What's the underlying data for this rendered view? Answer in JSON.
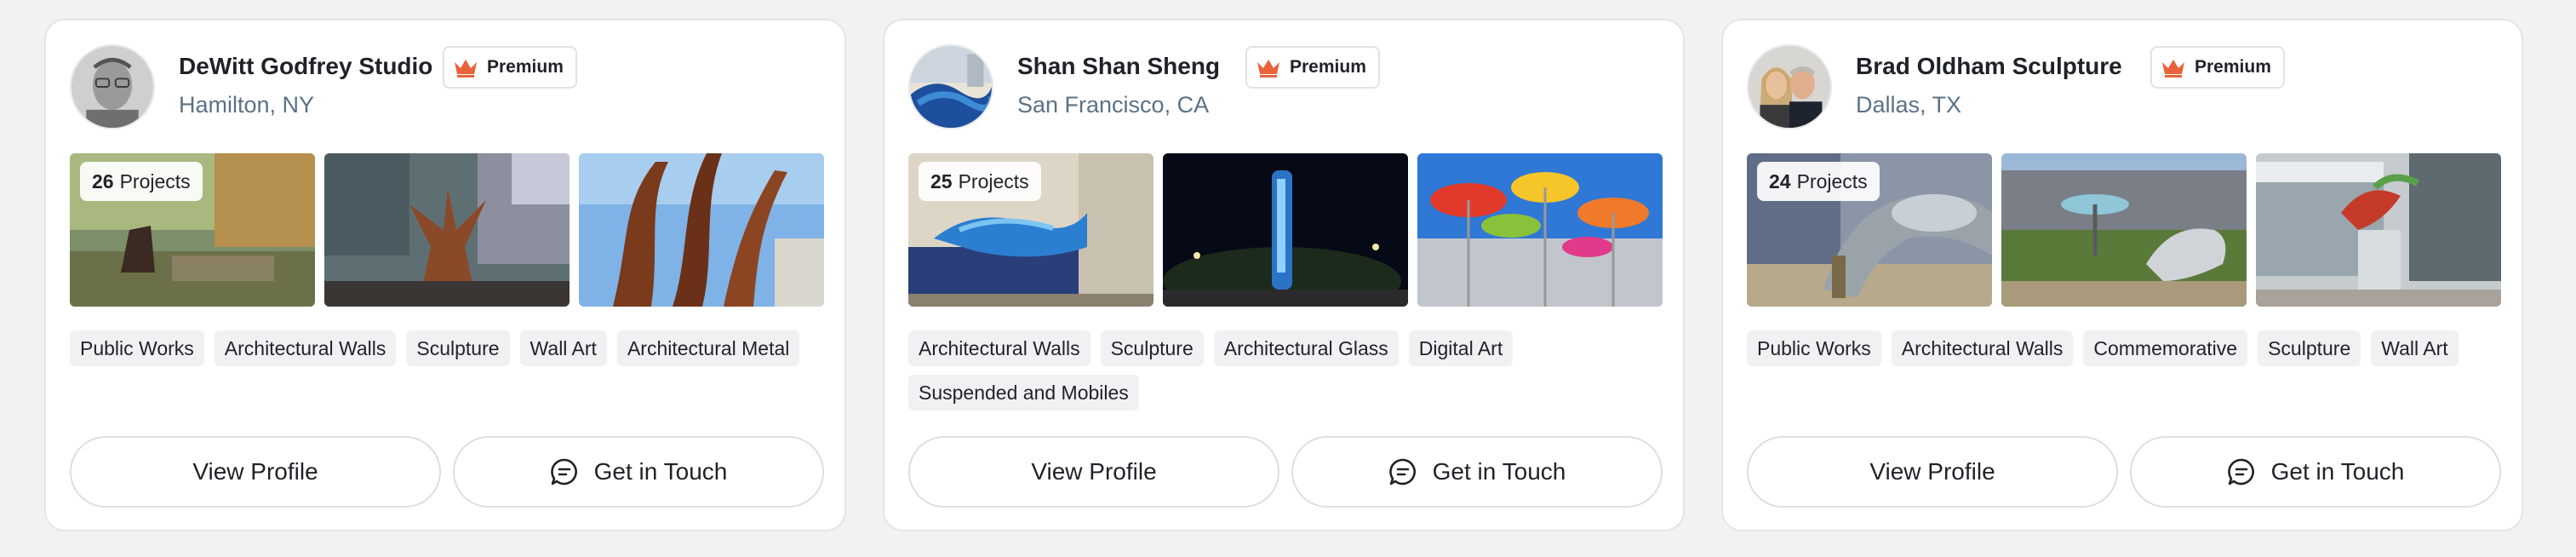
{
  "cards": [
    {
      "name": "DeWitt Godfrey Studio",
      "premium_label": "Premium",
      "location": "Hamilton, NY",
      "projects_count": "26",
      "projects_label": "Projects",
      "tags": [
        "Public Works",
        "Architectural Walls",
        "Sculpture",
        "Wall Art",
        "Architectural Metal"
      ],
      "view_profile_label": "View Profile",
      "get_in_touch_label": "Get in Touch"
    },
    {
      "name": "Shan Shan Sheng",
      "premium_label": "Premium",
      "location": "San Francisco, CA",
      "projects_count": "25",
      "projects_label": "Projects",
      "tags": [
        "Architectural Walls",
        "Sculpture",
        "Architectural Glass",
        "Digital Art",
        "Suspended and Mobiles"
      ],
      "view_profile_label": "View Profile",
      "get_in_touch_label": "Get in Touch"
    },
    {
      "name": "Brad Oldham Sculpture",
      "premium_label": "Premium",
      "location": "Dallas, TX",
      "projects_count": "24",
      "projects_label": "Projects",
      "tags": [
        "Public Works",
        "Architectural Walls",
        "Commemorative",
        "Sculpture",
        "Wall Art"
      ],
      "view_profile_label": "View Profile",
      "get_in_touch_label": "Get in Touch"
    }
  ],
  "colors": {
    "premium_crown": "#e8623a",
    "location_text": "#5b7286",
    "tag_bg": "#f0f1f2",
    "page_bg": "#f0f2f3"
  },
  "icons": {
    "premium": "crown-icon",
    "get_in_touch": "chat-bubble-icon"
  }
}
